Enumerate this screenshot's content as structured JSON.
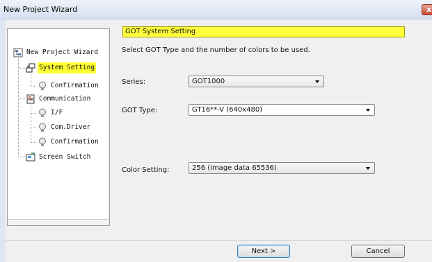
{
  "window": {
    "title": "New Project Wizard",
    "close_label": "x"
  },
  "tree": {
    "items": [
      {
        "label": "New Project Wizard",
        "icon": "project-icon",
        "selected": false
      },
      {
        "label": "System Setting",
        "icon": "system-icon",
        "selected": true
      },
      {
        "label": "Confirmation",
        "icon": "bulb-icon",
        "selected": false
      },
      {
        "label": "Communication",
        "icon": "communication-icon",
        "selected": false
      },
      {
        "label": "I/F",
        "icon": "bulb-icon",
        "selected": false
      },
      {
        "label": "Com.Driver",
        "icon": "bulb-icon",
        "selected": false
      },
      {
        "label": "Confirmation",
        "icon": "bulb-icon",
        "selected": false
      },
      {
        "label": "Screen Switch",
        "icon": "screen-icon",
        "selected": false
      }
    ]
  },
  "panel": {
    "header": "GOT System Setting",
    "instructions": "Select GOT Type and the number of colors to be used.",
    "series_label": "Series:",
    "series_value": "GOT1000",
    "got_type_label": "GOT Type:",
    "got_type_value": "GT16**-V (640x480)",
    "color_label": "Color Setting:",
    "color_value": "256 (image data 65536)"
  },
  "buttons": {
    "next": "Next >",
    "cancel": "Cancel"
  },
  "colors": {
    "highlight": "#ffff3c",
    "title_bar": "#dde6f2"
  }
}
